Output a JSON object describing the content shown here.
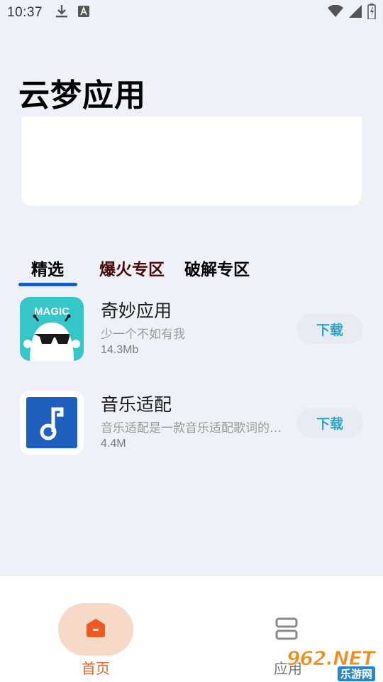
{
  "status_bar": {
    "time": "10:37"
  },
  "page_title": "云梦应用",
  "tabs": [
    {
      "label": "精选",
      "active": true
    },
    {
      "label": "爆火专区",
      "active": false
    },
    {
      "label": "破解专区",
      "active": false
    }
  ],
  "apps": [
    {
      "name": "奇妙应用",
      "description": "少一个不如有我",
      "size": "14.3Mb",
      "icon_text": "MAGIC",
      "download_label": "下载"
    },
    {
      "name": "音乐适配",
      "description": "音乐适配是一款音乐适配歌词的软件",
      "size": "4.4M",
      "download_label": "下载"
    }
  ],
  "bottom_nav": {
    "home_label": "首页",
    "apps_label": "应用"
  },
  "watermark": {
    "main": "962.NET",
    "sub": "乐游网"
  },
  "colors": {
    "background": "#eef2f8",
    "tab_indicator": "#1c5cc8",
    "download_text": "#2aa6c8",
    "home_accent": "#e0622a",
    "home_pill": "#f7d9c8"
  }
}
